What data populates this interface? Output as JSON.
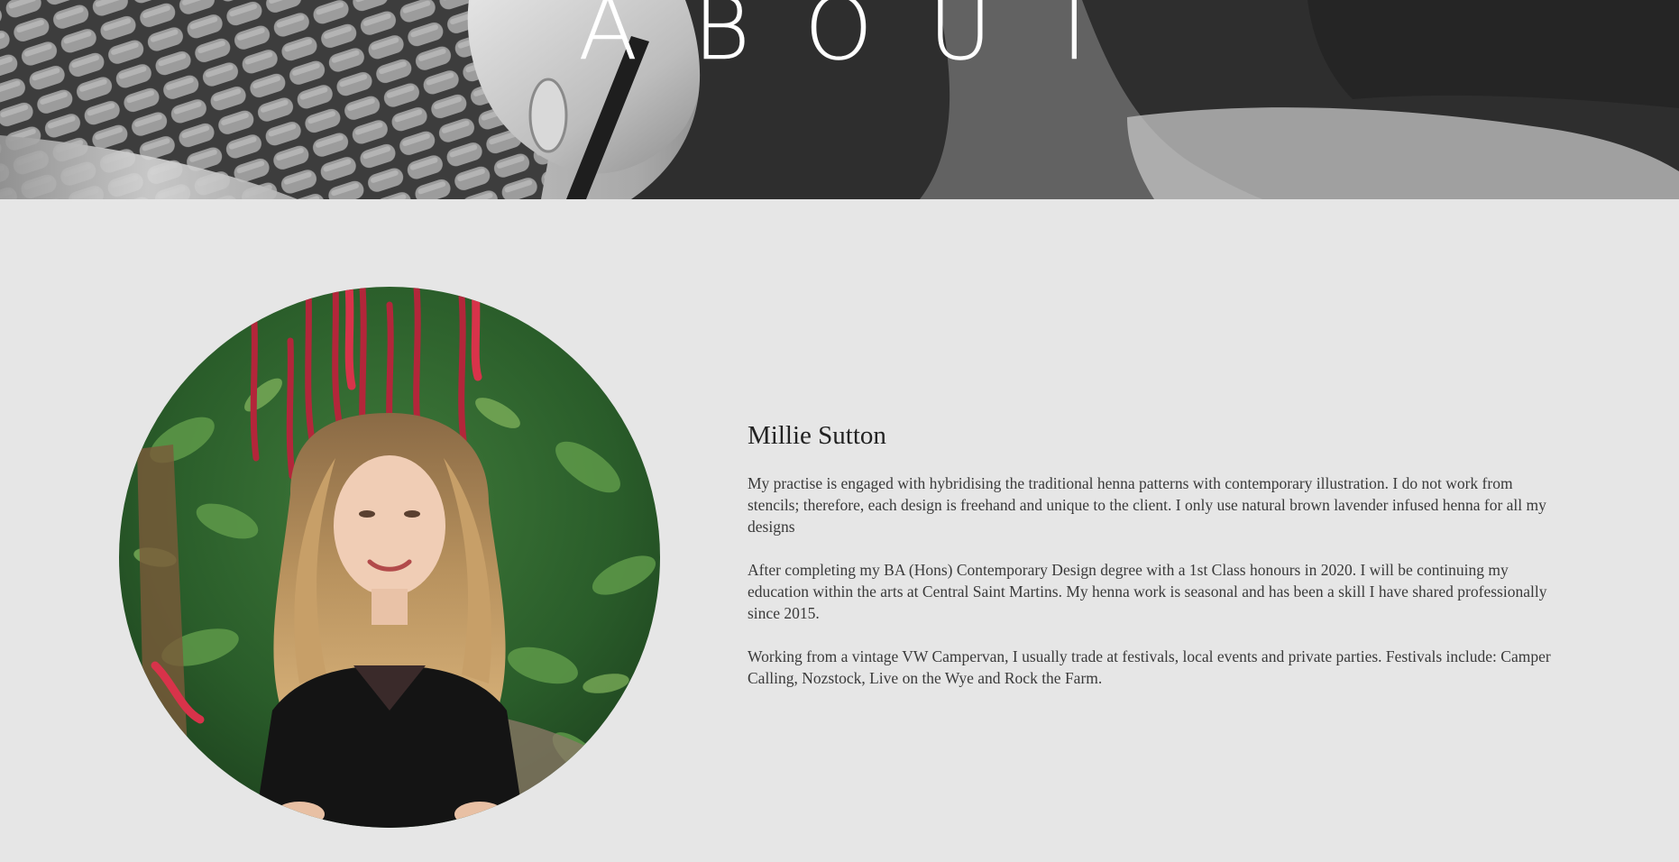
{
  "hero": {
    "title": "ABOUT"
  },
  "portrait": {
    "alt": "Portrait of Millie Sutton"
  },
  "bio": {
    "name": "Millie Sutton",
    "paragraphs": [
      "My practise is engaged with hybridising the traditional henna patterns with contemporary illustration. I do not work from stencils; therefore, each design is freehand and unique to the client. I only use natural brown lavender infused henna for all my designs",
      "After completing my BA (Hons) Contemporary Design degree with a 1st Class honours in 2020. I will be continuing my education within the arts at Central Saint Martins. My henna work is seasonal and has been a skill I have shared professionally since 2015.",
      "Working from a vintage VW Campervan, I usually trade at festivals, local events and private parties. Festivals include: Camper Calling, Nozstock, Live on the Wye and Rock the Farm."
    ]
  },
  "colors": {
    "page_background": "#e6e6e6",
    "heading_text": "#222222",
    "body_text": "#3a3a3a"
  }
}
